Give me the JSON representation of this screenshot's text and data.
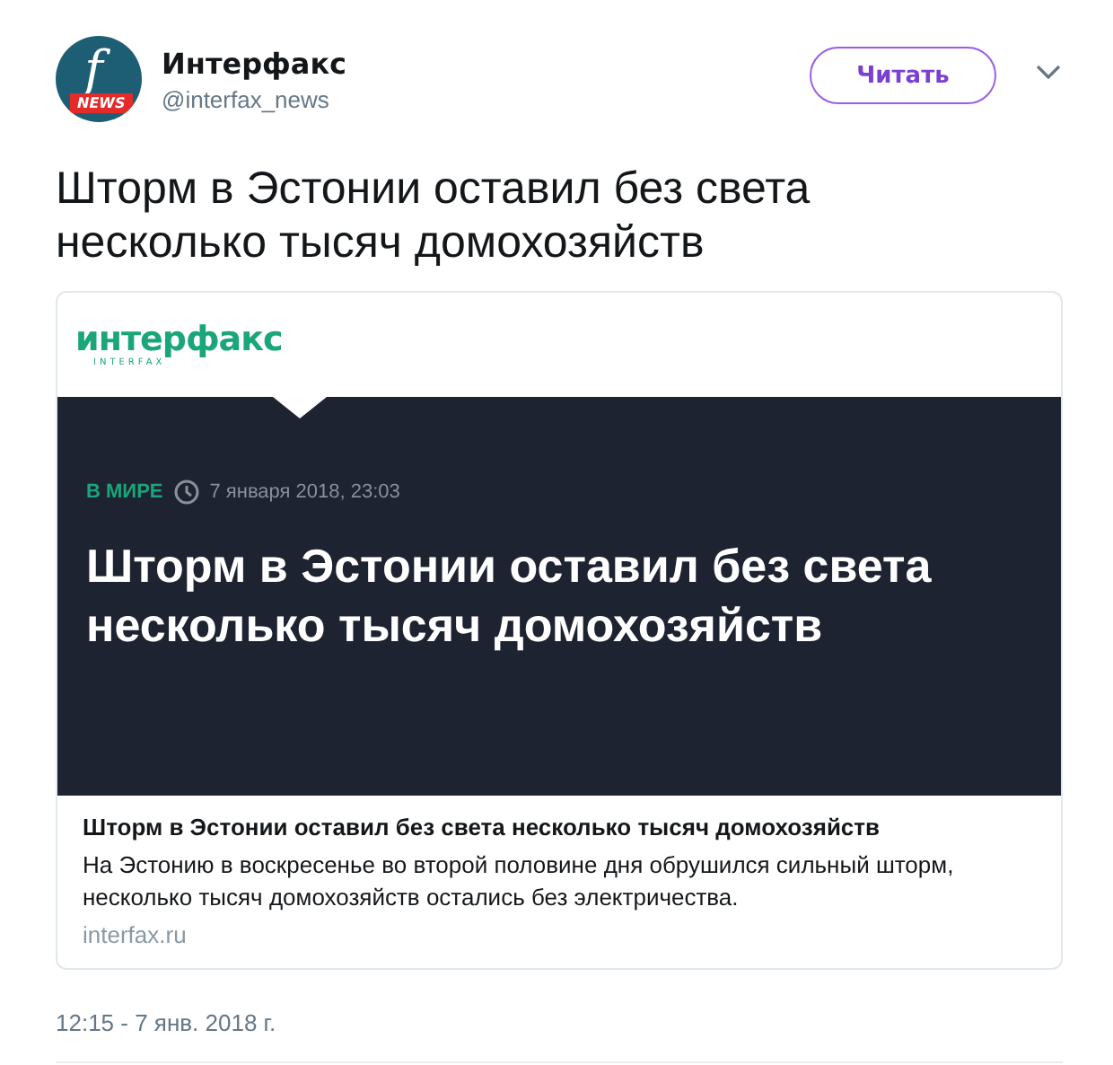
{
  "author": {
    "avatar_letter": "f",
    "avatar_badge": "NEWS",
    "name": "Интерфакс",
    "handle": "@interfax_news"
  },
  "follow_button": "Читать",
  "tweet_text": "Шторм в Эстонии оставил без света несколько тысяч домохозяйств",
  "card": {
    "logo": {
      "wordmark": "интерфакс",
      "subtitle": "INTERFAX"
    },
    "category": "В МИРЕ",
    "date": "7 января 2018, 23:03",
    "headline": "Шторм в Эстонии оставил без света несколько тысяч домохозяйств",
    "title": "Шторм в Эстонии оставил без света несколько тысяч домохозяйств",
    "description": "На Эстонию в воскресенье во второй половине дня обрушился сильный шторм, несколько тысяч домохозяйств остались без электричества.",
    "domain": "interfax.ru"
  },
  "timestamp": "12:15 - 7 янв. 2018 г."
}
